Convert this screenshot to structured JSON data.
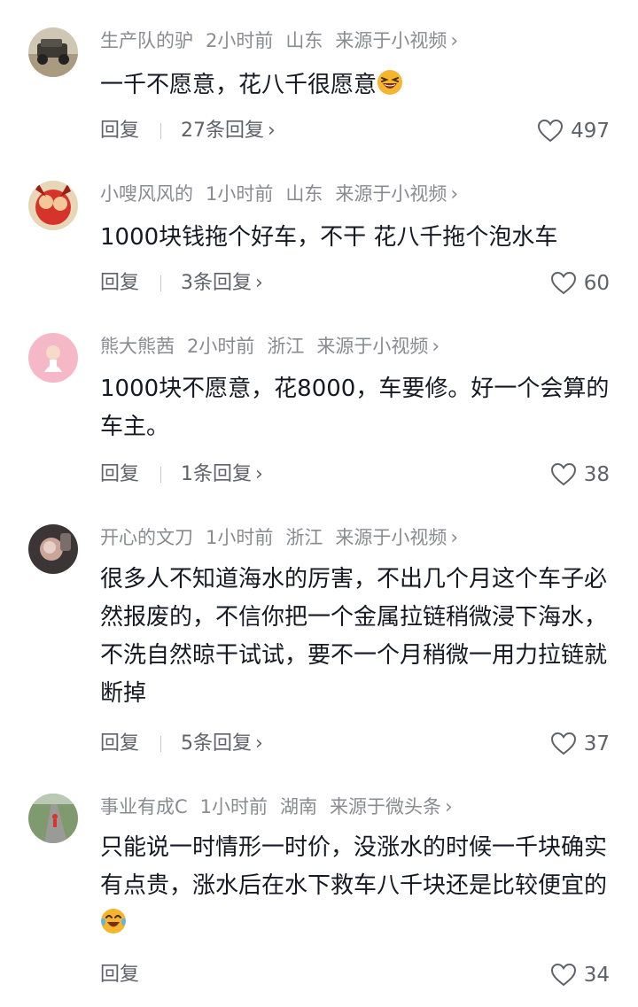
{
  "comments": [
    {
      "username": "生产队的驴",
      "time": "2小时前",
      "location": "山东",
      "source": "来源于小视频",
      "text": "一千不愿意，花八千很愿意",
      "emoji": "laughing-emoji",
      "reply_label": "回复",
      "replies_label": "27条回复",
      "likes": "497"
    },
    {
      "username": "小嗖风风的",
      "time": "1小时前",
      "location": "山东",
      "source": "来源于小视频",
      "text": "1000块钱拖个好车，不干 花八千拖个泡水车",
      "reply_label": "回复",
      "replies_label": "3条回复",
      "likes": "60"
    },
    {
      "username": "熊大熊茜",
      "time": "2小时前",
      "location": "浙江",
      "source": "来源于小视频",
      "text": "1000块不愿意，花8000，车要修。好一个会算的车主。",
      "reply_label": "回复",
      "replies_label": "1条回复",
      "likes": "38"
    },
    {
      "username": "开心的文刀",
      "time": "1小时前",
      "location": "浙江",
      "source": "来源于小视频",
      "text": "很多人不知道海水的厉害，不出几个月这个车子必然报废的，不信你把一个金属拉链稍微浸下海水，不洗自然晾干试试，要不一个月稍微一用力拉链就断掉",
      "reply_label": "回复",
      "replies_label": "5条回复",
      "likes": "37"
    },
    {
      "username": "事业有成C",
      "time": "1小时前",
      "location": "湖南",
      "source": "来源于微头条",
      "text": "只能说一时情形一时价，没涨水的时候一千块确实有点贵，涨水后在水下救车八千块还是比较便宜的",
      "emoji": "tears-of-joy-emoji",
      "reply_label": "回复",
      "likes": "34"
    }
  ],
  "icons": {
    "chevron": "›",
    "heart": "heart-outline-icon"
  },
  "colors": {
    "text": "#161823",
    "meta": "#8a8b91",
    "action": "#60616a",
    "emoji": "#f5b52e"
  }
}
